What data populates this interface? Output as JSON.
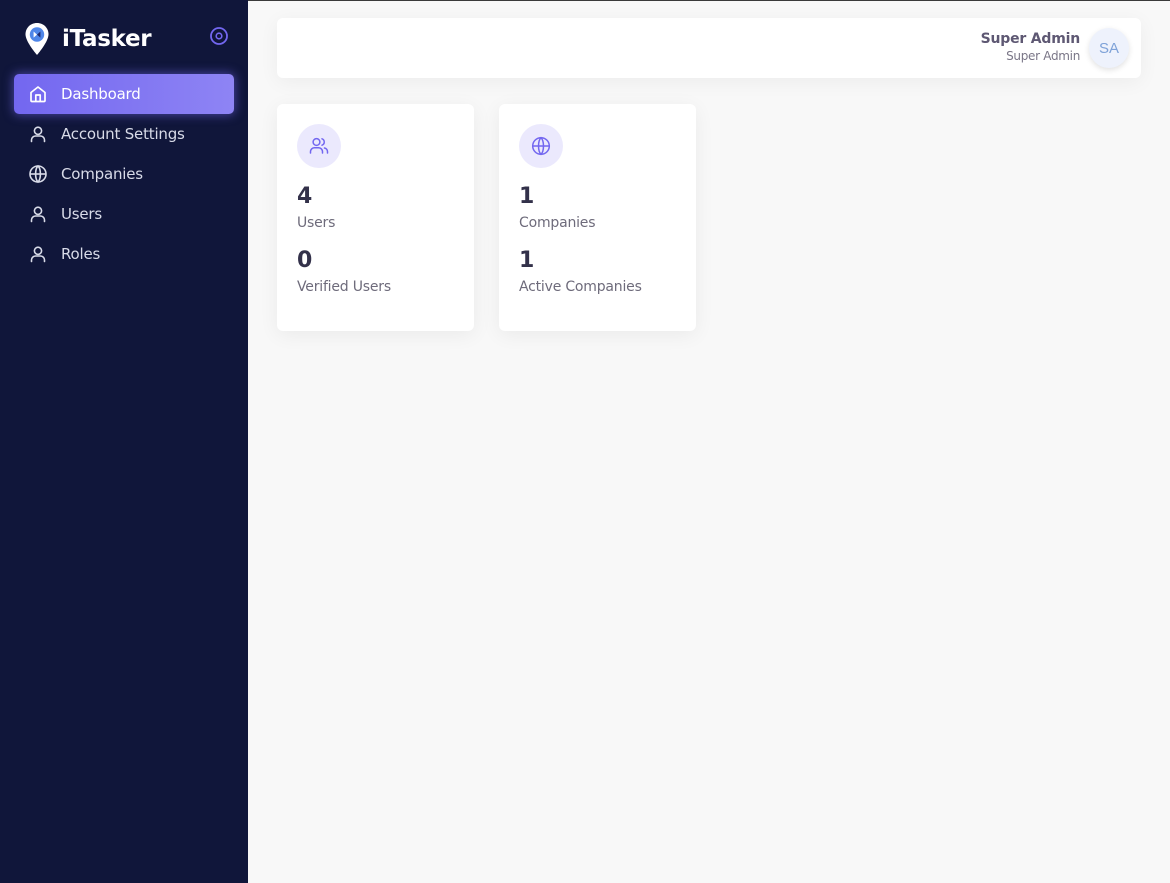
{
  "brand": {
    "name": "iTasker",
    "accent": "#7367f0",
    "sidebar_bg": "#10163a"
  },
  "sidebar": {
    "items": [
      {
        "label": "Dashboard",
        "icon": "home-icon",
        "active": true
      },
      {
        "label": "Account Settings",
        "icon": "user-icon",
        "active": false
      },
      {
        "label": "Companies",
        "icon": "globe-icon",
        "active": false
      },
      {
        "label": "Users",
        "icon": "user-icon",
        "active": false
      },
      {
        "label": "Roles",
        "icon": "user-icon",
        "active": false
      }
    ]
  },
  "header": {
    "user_name": "Super Admin",
    "user_role": "Super Admin",
    "avatar_initials": "SA"
  },
  "cards": [
    {
      "icon": "users-icon",
      "stats": [
        {
          "value": "4",
          "label": "Users"
        },
        {
          "value": "0",
          "label": "Verified Users"
        }
      ]
    },
    {
      "icon": "globe-icon",
      "stats": [
        {
          "value": "1",
          "label": "Companies"
        },
        {
          "value": "1",
          "label": "Active Companies"
        }
      ]
    }
  ]
}
